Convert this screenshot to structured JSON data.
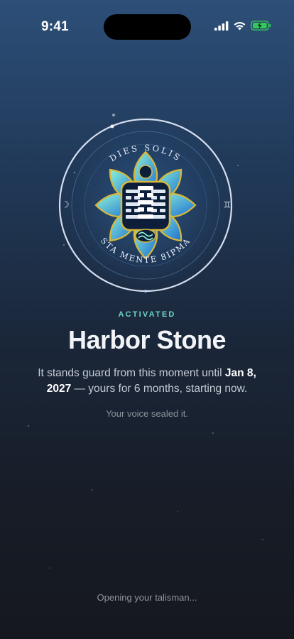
{
  "status_bar": {
    "time": "9:41",
    "icons": [
      "signal-icon",
      "wifi-icon",
      "battery-charging-icon"
    ],
    "battery_color": "#34c759"
  },
  "seal": {
    "top_inscription": "DIES SOLIS",
    "bottom_inscription": "STA MENTE 8IPMA",
    "left_glyph": "☽",
    "right_glyph": "♊",
    "emblem": "lotus-trigram-emblem"
  },
  "status_label": "ACTIVATED",
  "talisman_name": "Harbor Stone",
  "description": {
    "lead": "It stands guard from this moment until ",
    "date": "Jan 8, 2027",
    "tail": " — yours for 6 months, starting now."
  },
  "sealed_note": "Your voice sealed it.",
  "loading_text": "Opening your talisman...",
  "colors": {
    "accent": "#6fd6c8",
    "background_top": "#2d4f78",
    "background_bottom": "#15181f"
  }
}
